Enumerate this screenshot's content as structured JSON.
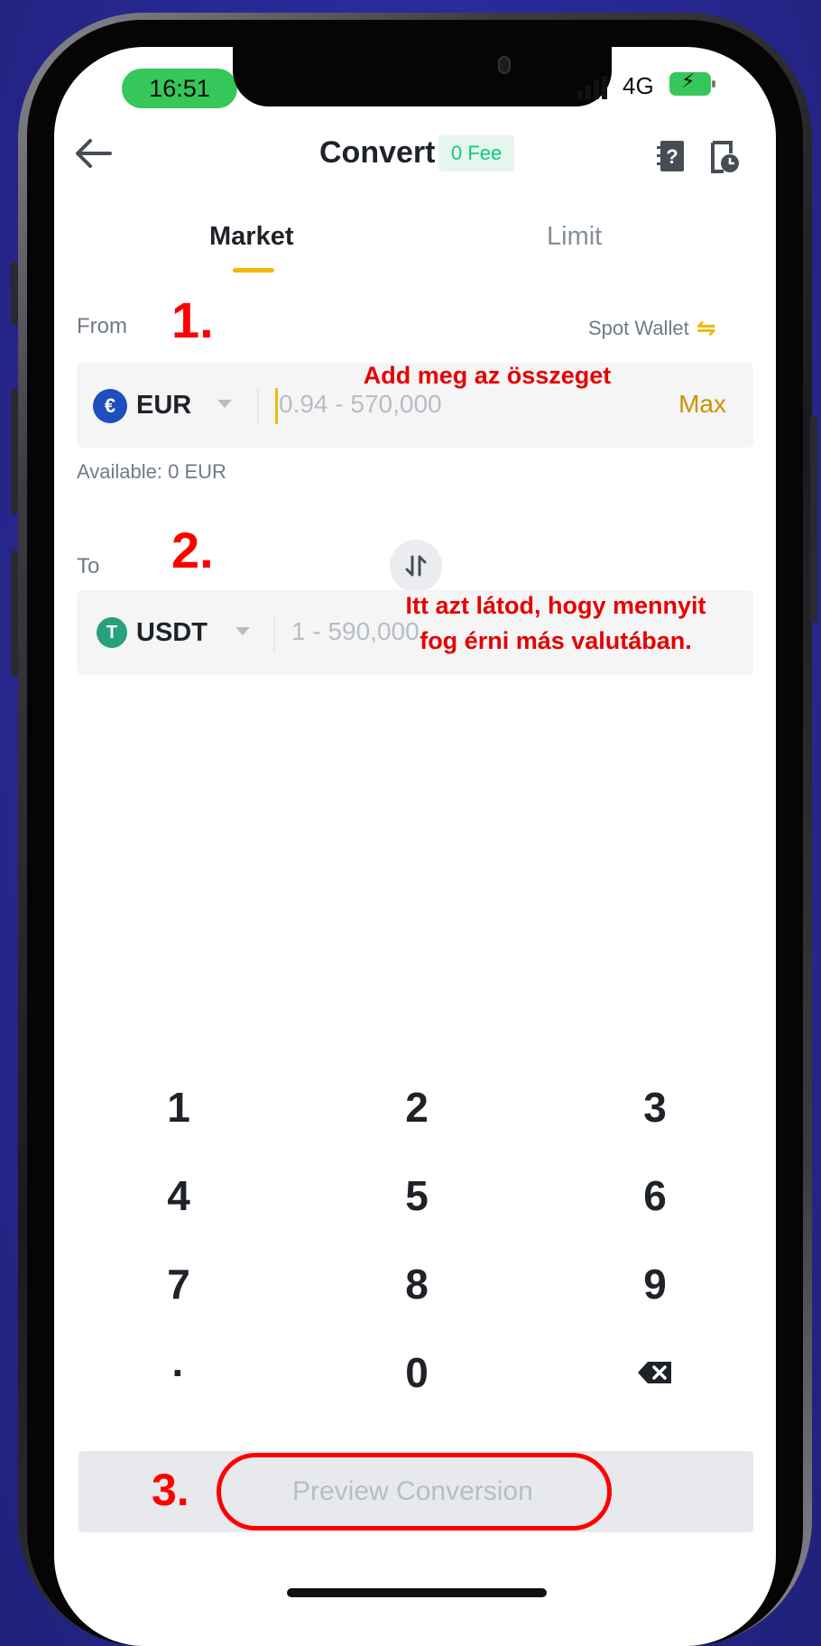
{
  "status_bar": {
    "time": "16:51",
    "network": "4G"
  },
  "header": {
    "title": "Convert",
    "fee_badge": "0 Fee"
  },
  "tabs": [
    {
      "label": "Market",
      "active": true
    },
    {
      "label": "Limit",
      "active": false
    }
  ],
  "from": {
    "label": "From",
    "wallet_label": "Spot Wallet",
    "currency": "EUR",
    "currency_symbol": "€",
    "placeholder": "0.94 - 570,000",
    "max_label": "Max",
    "available": "Available: 0 EUR"
  },
  "to": {
    "label": "To",
    "currency": "USDT",
    "currency_symbol": "T",
    "placeholder": "1 - 590,000"
  },
  "keypad": [
    "1",
    "2",
    "3",
    "4",
    "5",
    "6",
    "7",
    "8",
    "9",
    "·",
    "0",
    "⌫"
  ],
  "primary_button": {
    "label": "Preview Conversion"
  },
  "annotations": {
    "step1": "1.",
    "step2": "2.",
    "step3": "3.",
    "from_hint": "Add meg az összeget",
    "to_hint_line1": "Itt azt látod, hogy mennyit",
    "to_hint_line2": "fog érni más valutában."
  },
  "colors": {
    "accent": "#f0b90b",
    "green": "#0ecb81",
    "annotation": "#ff0000",
    "eur_icon": "#1e4fbf",
    "usdt_icon": "#26a17b"
  }
}
